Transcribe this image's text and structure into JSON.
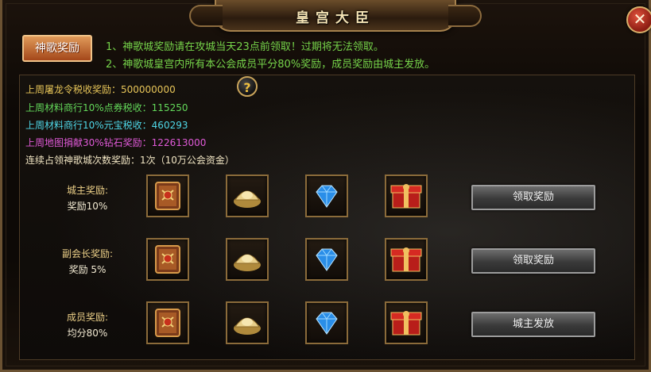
{
  "window": {
    "title": "皇宫大臣",
    "close_glyph": "✕"
  },
  "tab": {
    "label": "神歌奖励"
  },
  "rules": [
    "1、神歌城奖励请在攻城当天23点前领取！过期将无法领取。",
    "2、神歌城皇宫内所有本公会成员平分80%奖励，成员奖励由城主发放。"
  ],
  "info": [
    {
      "text": "上周屠龙令税收奖励：500000000",
      "color": "#e8c659"
    },
    {
      "text": "上周材料商行10%点券税收：115250",
      "color": "#63d85a"
    },
    {
      "text": "上周材料商行10%元宝税收：460293",
      "color": "#4fd8e8"
    },
    {
      "text": "上周地图捐献30%钻石奖励：122613000",
      "color": "#e05ad8"
    },
    {
      "text": "连续占领神歌城次数奖励：1次（10万公会资金）",
      "color": "#f2e6c4"
    }
  ],
  "help": {
    "glyph": "?"
  },
  "reward_rows": [
    {
      "label": "城主奖励:",
      "share": "奖励10%",
      "button": "领取奖励",
      "items": [
        "scroll-icon",
        "gold-ingot-icon",
        "diamond-icon",
        "red-gift-box-icon"
      ]
    },
    {
      "label": "副会长奖励:",
      "share": "奖励 5%",
      "button": "领取奖励",
      "items": [
        "scroll-icon",
        "gold-ingot-icon",
        "diamond-icon",
        "red-gift-box-icon"
      ]
    },
    {
      "label": "成员奖励:",
      "share": "均分80%",
      "button": "城主发放",
      "items": [
        "scroll-icon",
        "gold-ingot-icon",
        "diamond-icon",
        "red-gift-box-icon"
      ]
    }
  ]
}
